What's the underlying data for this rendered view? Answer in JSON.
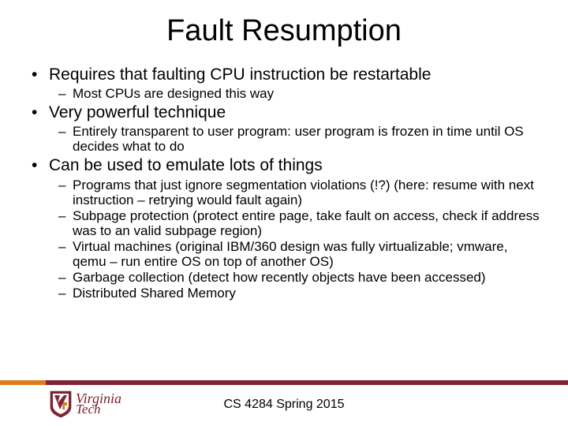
{
  "title": "Fault Resumption",
  "bullets": [
    {
      "text": "Requires that faulting CPU instruction be restartable",
      "sub": [
        "Most CPUs are designed this way"
      ]
    },
    {
      "text": "Very powerful technique",
      "sub": [
        "Entirely transparent to user program: user program is frozen in time until OS decides what to do"
      ]
    },
    {
      "text": "Can be used to emulate lots of things",
      "sub": [
        "Programs that just ignore segmentation violations (!?) (here: resume with next instruction – retrying would fault again)",
        "Subpage protection (protect entire page, take fault on access, check if address was to an valid subpage region)",
        "Virtual machines (original IBM/360 design was fully virtualizable; vmware, qemu – run entire OS on top of another OS)",
        "Garbage collection (detect how recently objects have been accessed)",
        "Distributed Shared Memory"
      ]
    }
  ],
  "logo": {
    "line1": "Virginia",
    "line2": "Tech"
  },
  "footer": "CS 4284 Spring 2015"
}
